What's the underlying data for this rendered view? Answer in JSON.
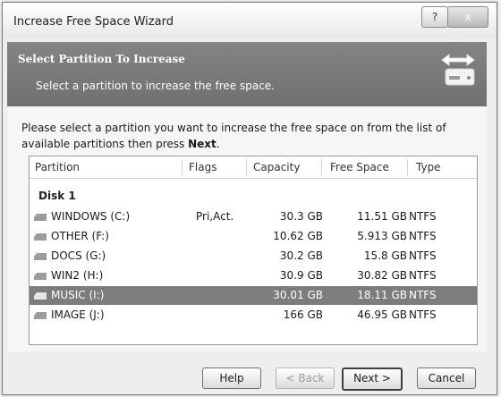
{
  "window": {
    "title": "Increase Free Space Wizard",
    "help_label": "?",
    "close_label": "x"
  },
  "banner": {
    "title": "Select Partition To Increase",
    "subtitle": "Select a partition to increase the free space."
  },
  "instructions": {
    "text": "Please select a partition you want to increase the free space on from the list of available partitions then press",
    "emphasis": "Next",
    "end": "."
  },
  "columns": {
    "partition": "Partition",
    "flags": "Flags",
    "capacity": "Capacity",
    "free_space": "Free Space",
    "type": "Type"
  },
  "group": {
    "label": "Disk 1"
  },
  "partitions": [
    {
      "name": "WINDOWS (C:)",
      "flags": "Pri,Act.",
      "capacity": "30.3 GB",
      "free": "11.51 GB",
      "type": "NTFS"
    },
    {
      "name": "OTHER (F:)",
      "flags": "",
      "capacity": "10.62 GB",
      "free": "5.913 GB",
      "type": "NTFS"
    },
    {
      "name": "DOCS (G:)",
      "flags": "",
      "capacity": "30.2 GB",
      "free": "15.8 GB",
      "type": "NTFS"
    },
    {
      "name": "WIN2 (H:)",
      "flags": "",
      "capacity": "30.9 GB",
      "free": "30.82 GB",
      "type": "NTFS"
    },
    {
      "name": "MUSIC (I:)",
      "flags": "",
      "capacity": "30.01 GB",
      "free": "18.11 GB",
      "type": "NTFS"
    },
    {
      "name": "IMAGE (J:)",
      "flags": "",
      "capacity": "166 GB",
      "free": "46.95 GB",
      "type": "NTFS"
    }
  ],
  "selected_partition": "MUSIC (I:)",
  "buttons": {
    "help": "Help",
    "back": "< Back",
    "next": "Next >",
    "cancel": "Cancel"
  },
  "icons": {
    "banner": "drive-resize-icon",
    "partition": "drive-icon",
    "help": "help-icon",
    "close": "close-icon"
  },
  "colors": {
    "banner": "#7a7a7a",
    "selection": "#7d7d7d"
  }
}
